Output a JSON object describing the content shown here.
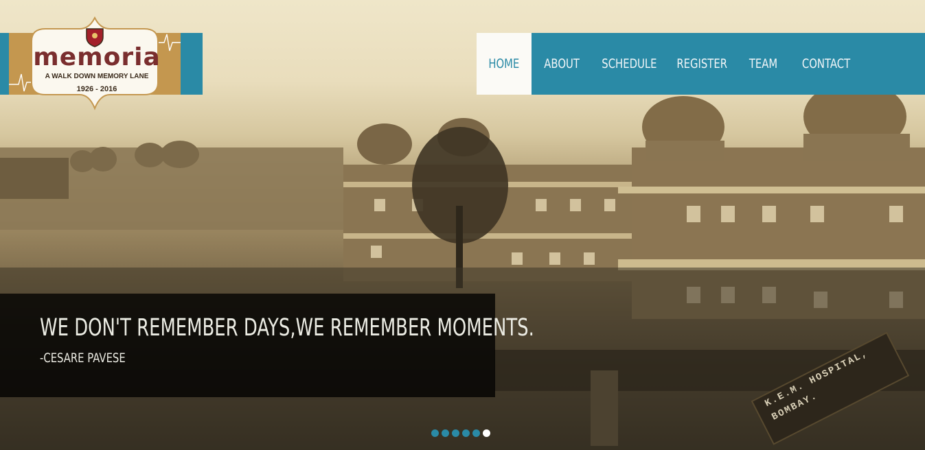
{
  "logo": {
    "wordmark": "memoria",
    "tagline": "A WALK DOWN MEMORY LANE",
    "years": "1926 - 2016"
  },
  "nav": {
    "items": [
      {
        "label": "HOME",
        "active": true
      },
      {
        "label": "ABOUT",
        "active": false
      },
      {
        "label": "SCHEDULE",
        "active": false
      },
      {
        "label": "REGISTER",
        "active": false
      },
      {
        "label": "TEAM",
        "active": false
      },
      {
        "label": "CONTACT",
        "active": false
      }
    ]
  },
  "slide": {
    "quote": "WE DON'T REMEMBER DAYS,WE REMEMBER MOMENTS.",
    "author": "-CESARE PAVESE",
    "signboard_text": "K.E.M. HOSPITAL, BOMBAY."
  },
  "slider": {
    "total": 6,
    "active_index": 5
  },
  "colors": {
    "accent": "#2a8aa6",
    "active_nav_bg": "#fbfaf6",
    "logo_brown": "#7a2e2e"
  }
}
